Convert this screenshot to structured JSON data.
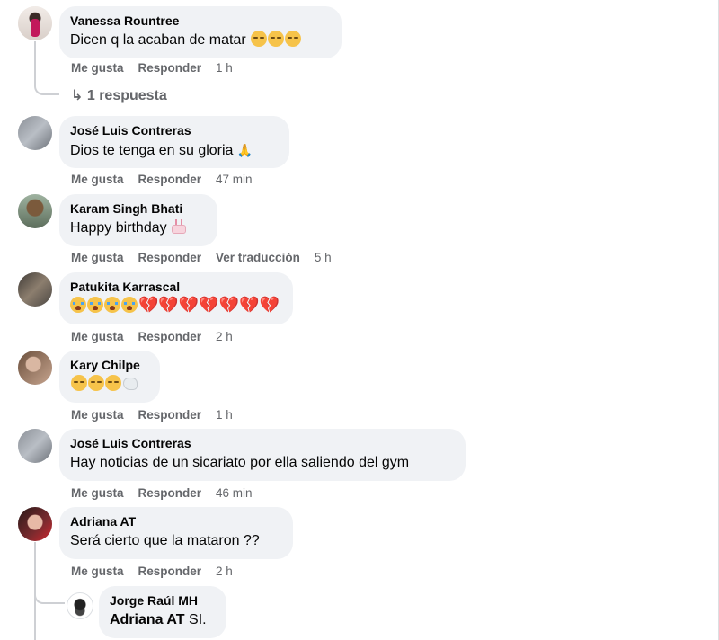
{
  "actions": {
    "like": "Me gusta",
    "reply": "Responder",
    "translate": "Ver traducción"
  },
  "comments": [
    {
      "author": "Vanessa Rountree",
      "text": "Dicen q la acaban de matar",
      "emoji": "sad-face x3",
      "time": "1 h",
      "replies_label": "1 respuesta"
    },
    {
      "author": "José Luis Contreras",
      "text": "Dios te tenga en su gloria",
      "emoji": "praying-hands",
      "time": "47 min"
    },
    {
      "author": "Karam Singh Bhati",
      "text": "Happy birthday",
      "emoji": "birthday-cake",
      "time": "5 h"
    },
    {
      "author": "Patukita Karrascal",
      "text": "",
      "emoji": "crying-face x4, broken-heart x7",
      "time": "2 h"
    },
    {
      "author": "Kary Chilpe",
      "text": "",
      "emoji": "sad-face x3, dove",
      "time": "1 h"
    },
    {
      "author": "José Luis Contreras",
      "text": "Hay noticias de un sicariato por ella saliendo del gym",
      "time": "46 min"
    },
    {
      "author": "Adriana AT",
      "text": "Será cierto que la mataron ??",
      "time": "2 h"
    },
    {
      "author": "Jorge Raúl MH",
      "mention": "Adriana AT",
      "text": "SI."
    }
  ],
  "colors": {
    "bubble": "#f0f2f5",
    "meta": "#65676b",
    "text": "#050505"
  }
}
